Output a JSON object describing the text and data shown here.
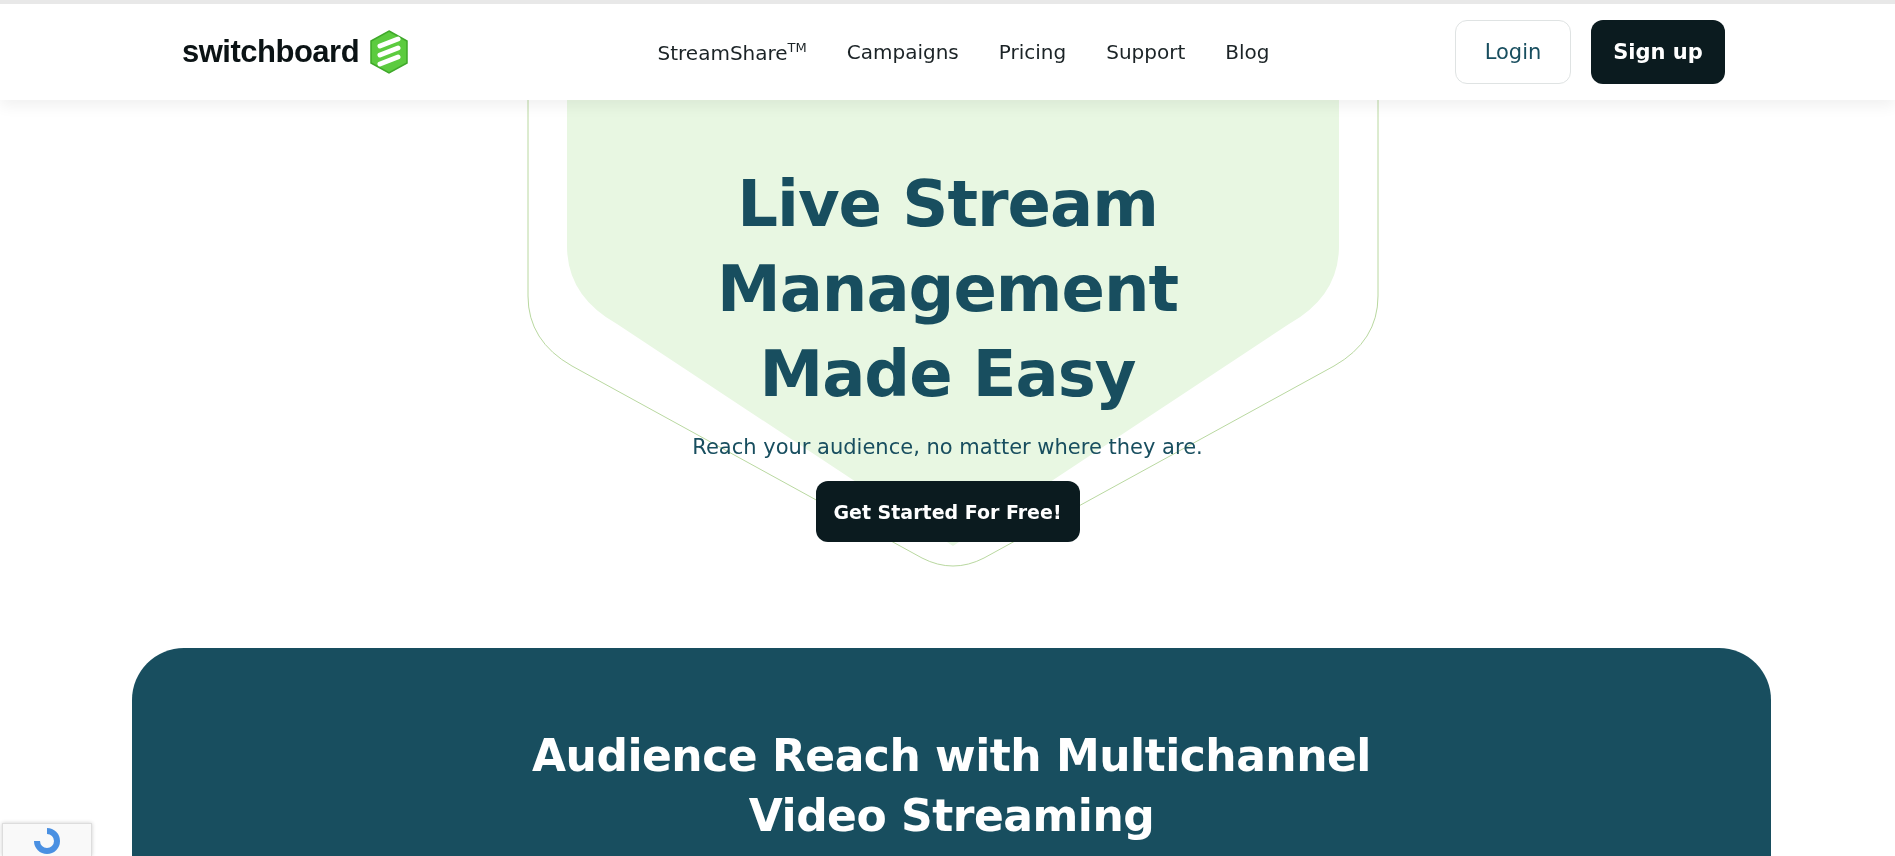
{
  "header": {
    "logo": "switchboard",
    "nav": [
      "StreamShare$^{TM}$",
      "Campaigns",
      "Pricing",
      "Support",
      "Blog"
    ],
    "login": "Login",
    "signup": "Sign up"
  },
  "hero": {
    "title": [
      "Live Stream",
      "Management",
      "Made Easy"
    ],
    "subtitle": "Reach your audience, no matter where they are.",
    "cta": "Get Started For Free!"
  },
  "feature": {
    "title": [
      "Audience Reach with Multichannel",
      "Video Streaming"
    ]
  }
}
